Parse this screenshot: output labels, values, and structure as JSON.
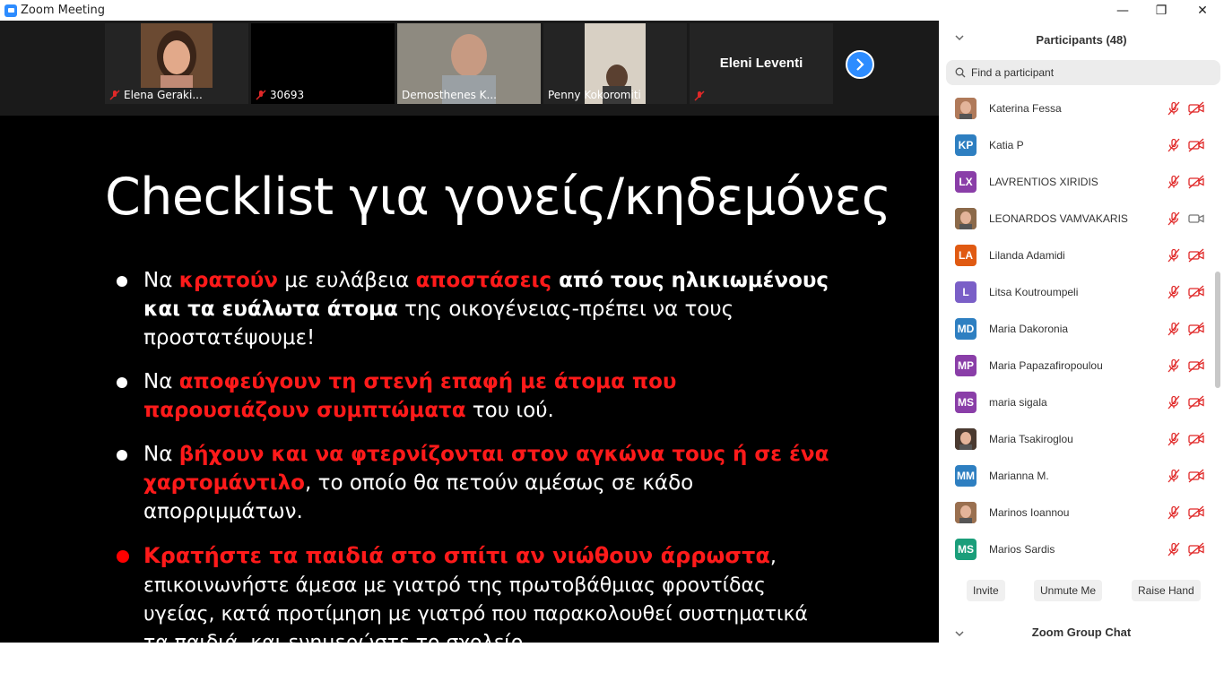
{
  "window": {
    "title": "Zoom Meeting",
    "controls": {
      "minimize": "—",
      "maximize": "❐",
      "close": "✕"
    }
  },
  "video_strip": {
    "tiles": [
      {
        "name": "Elena Geraki...",
        "muted": true
      },
      {
        "name": "30693",
        "muted": true
      },
      {
        "name": "Demosthenes K...",
        "muted": false,
        "active": true
      },
      {
        "name": "Penny Kokoromiti",
        "muted": false
      },
      {
        "name": "Eleni Leventi",
        "muted": true
      }
    ]
  },
  "slide": {
    "title": "Checklist για γονείς/κηδεμόνες",
    "b1": {
      "t1": "Να ",
      "r1": "κρατούν",
      "t2": " με ευλάβεια ",
      "r2": "αποστάσεις",
      "w1": " από τους ηλικιωμένους και τα ευάλωτα άτομα",
      "t3": " της οικογένειας-πρέπει να τους προστατέψουμε!"
    },
    "b2": {
      "t1": "Να ",
      "r1": "αποφεύγουν τη στενή επαφή με άτομα που παρουσιάζουν συμπτώματα",
      "t2": " του ιού."
    },
    "b3": {
      "t1": "Να ",
      "r1": "βήχουν και να φτερνίζονται στον αγκώνα τους ή σε ένα χαρτομάντιλο",
      "t2": ", το οποίο θα πετούν αμέσως σε κάδο απορριμμάτων."
    },
    "b4": {
      "r1": "Κρατήστε τα παιδιά στο σπίτι αν νιώθουν άρρωστα",
      "t1": ", επικοινωνήστε άμεσα με γιατρό της πρωτοβάθμιας φροντίδας υγείας, κατά προτίμηση με γιατρό που παρακολουθεί συστηματικά τα παιδιά, και ενημερώστε το σχολείο."
    }
  },
  "panel": {
    "title": "Participants (48)",
    "search_placeholder": "Find a participant",
    "participants": [
      {
        "name": "Katerina Fessa",
        "initials": "",
        "color": "#b07a5a",
        "photo": true,
        "video_on": false
      },
      {
        "name": "Katia P",
        "initials": "KP",
        "color": "#2e7fc1",
        "video_on": false
      },
      {
        "name": "LAVRENTIOS XIRIDIS",
        "initials": "LX",
        "color": "#8a3ea8",
        "video_on": false
      },
      {
        "name": "LEONARDOS VAMVAKARIS",
        "initials": "",
        "color": "#8c6a4a",
        "photo": true,
        "video_on": true
      },
      {
        "name": "Lilanda Adamidi",
        "initials": "LA",
        "color": "#e05a12",
        "video_on": false
      },
      {
        "name": "Litsa Koutroumpeli",
        "initials": "L",
        "color": "#7a5fc7",
        "video_on": false
      },
      {
        "name": "Maria Dakoronia",
        "initials": "MD",
        "color": "#2e7fc1",
        "video_on": false
      },
      {
        "name": "Maria Papazafiropoulou",
        "initials": "MP",
        "color": "#8a3ea8",
        "video_on": false
      },
      {
        "name": "maria sigala",
        "initials": "MS",
        "color": "#8a3ea8",
        "video_on": false
      },
      {
        "name": "Maria Tsakiroglou",
        "initials": "",
        "color": "#4a3a30",
        "photo": true,
        "video_on": false
      },
      {
        "name": "Marianna M.",
        "initials": "MM",
        "color": "#2e7fc1",
        "video_on": false
      },
      {
        "name": "Marinos Ioannou",
        "initials": "",
        "color": "#9a7050",
        "photo": true,
        "video_on": false
      },
      {
        "name": "Marios Sardis",
        "initials": "MS",
        "color": "#1a9e7a",
        "video_on": false
      }
    ],
    "actions": {
      "invite": "Invite",
      "unmute": "Unmute Me",
      "raise_hand": "Raise Hand"
    },
    "chat_title": "Zoom Group Chat"
  }
}
